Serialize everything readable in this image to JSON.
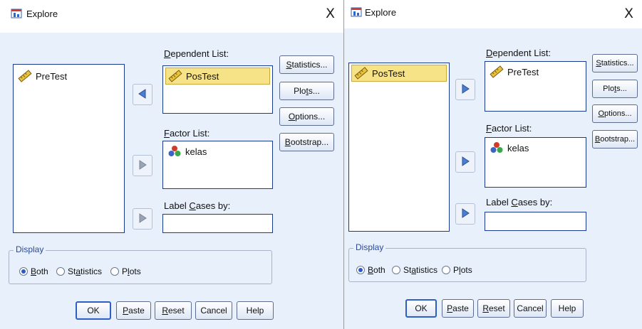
{
  "dialogs": [
    {
      "title": "Explore",
      "close_glyph": "X",
      "variable_list": [
        {
          "name": "PreTest",
          "icon": "ruler-scale-icon",
          "selected": false
        }
      ],
      "dependent_label_pre": "",
      "dependent_label_mn": "D",
      "dependent_label_post": "ependent List:",
      "dependent_list": [
        {
          "name": "PosTest",
          "icon": "ruler-scale-icon",
          "selected": true
        }
      ],
      "factor_label_pre": "",
      "factor_label_mn": "F",
      "factor_label_post": "actor List:",
      "factor_list": [
        {
          "name": "kelas",
          "icon": "nominal-variable-icon"
        }
      ],
      "label_cases_pre": "Label ",
      "label_cases_mn": "C",
      "label_cases_post": "ases by:",
      "label_cases_value": "",
      "arrow_directions": [
        "left",
        "right",
        "right"
      ],
      "side_buttons": [
        {
          "pre": "",
          "mn": "S",
          "post": "tatistics..."
        },
        {
          "pre": "Plo",
          "mn": "t",
          "post": "s..."
        },
        {
          "pre": "",
          "mn": "O",
          "post": "ptions..."
        },
        {
          "pre": "",
          "mn": "B",
          "post": "ootstrap..."
        }
      ],
      "display_title": "Display",
      "display_options": [
        {
          "pre": "",
          "mn": "B",
          "post": "oth",
          "checked": true
        },
        {
          "pre": "St",
          "mn": "a",
          "post": "tistics",
          "checked": false
        },
        {
          "pre": "P",
          "mn": "l",
          "post": "ots",
          "checked": false
        }
      ],
      "bottom_buttons": [
        {
          "pre": "OK",
          "mn": "",
          "post": ""
        },
        {
          "pre": "",
          "mn": "P",
          "post": "aste"
        },
        {
          "pre": "",
          "mn": "R",
          "post": "eset"
        },
        {
          "pre": "Cancel",
          "mn": "",
          "post": ""
        },
        {
          "pre": "Help",
          "mn": "",
          "post": ""
        }
      ]
    },
    {
      "title": "Explore",
      "close_glyph": "X",
      "variable_list": [
        {
          "name": "PosTest",
          "icon": "ruler-scale-icon",
          "selected": true
        }
      ],
      "dependent_label_pre": "",
      "dependent_label_mn": "D",
      "dependent_label_post": "ependent List:",
      "dependent_list": [
        {
          "name": "PreTest",
          "icon": "ruler-scale-icon",
          "selected": false
        }
      ],
      "factor_label_pre": "",
      "factor_label_mn": "F",
      "factor_label_post": "actor List:",
      "factor_list": [
        {
          "name": "kelas",
          "icon": "nominal-variable-icon"
        }
      ],
      "label_cases_pre": "Label ",
      "label_cases_mn": "C",
      "label_cases_post": "ases by:",
      "label_cases_value": "",
      "arrow_directions": [
        "right",
        "right",
        "right"
      ],
      "side_buttons": [
        {
          "pre": "",
          "mn": "S",
          "post": "tatistics..."
        },
        {
          "pre": "Plo",
          "mn": "t",
          "post": "s..."
        },
        {
          "pre": "",
          "mn": "O",
          "post": "ptions..."
        },
        {
          "pre": "",
          "mn": "B",
          "post": "ootstrap..."
        }
      ],
      "display_title": "Display",
      "display_options": [
        {
          "pre": "",
          "mn": "B",
          "post": "oth",
          "checked": true
        },
        {
          "pre": "St",
          "mn": "a",
          "post": "tistics",
          "checked": false
        },
        {
          "pre": "P",
          "mn": "l",
          "post": "ots",
          "checked": false
        }
      ],
      "bottom_buttons": [
        {
          "pre": "OK",
          "mn": "",
          "post": ""
        },
        {
          "pre": "",
          "mn": "P",
          "post": "aste"
        },
        {
          "pre": "",
          "mn": "R",
          "post": "eset"
        },
        {
          "pre": "Cancel",
          "mn": "",
          "post": ""
        },
        {
          "pre": "Help",
          "mn": "",
          "post": ""
        }
      ]
    }
  ],
  "colors": {
    "client_bg": "#e8f0fb",
    "list_border": "#1a3a8f",
    "selection_bg": "#f6e387",
    "arrow_blue": "#4a7fd0",
    "arrow_grey": "#9aa4b4",
    "group_title": "#2a4a9a"
  }
}
